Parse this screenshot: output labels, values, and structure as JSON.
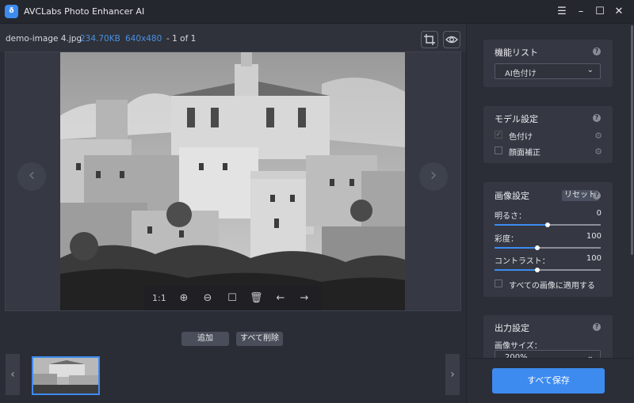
{
  "window": {
    "title": "AVCLabs Photo Enhancer AI",
    "logo_glyph": "ð",
    "controls": {
      "menu": "☰",
      "minimize": "–",
      "maximize": "☐",
      "close": "✕"
    }
  },
  "file_info": {
    "name": "demo-image 4.jpg",
    "size": "234.70KB",
    "dimensions": "640x480",
    "page": "- 1 of 1"
  },
  "viewer": {
    "prev": "‹",
    "next": "›",
    "toolbar": {
      "ratio": "1:1",
      "zoom_in": "⊕",
      "zoom_out": "⊖",
      "fit": "☐",
      "delete": "🗑",
      "back": "←",
      "forward": "→"
    }
  },
  "bottom": {
    "add_label": "追加",
    "delete_all_label": "すべて削除",
    "prev": "‹",
    "next": "›"
  },
  "panel": {
    "features": {
      "title": "機能リスト",
      "help": "?",
      "selected": "AI色付け",
      "chevron": "⌄"
    },
    "model": {
      "title": "モデル設定",
      "help": "?",
      "options": [
        {
          "label": "色付け",
          "checked": true,
          "check_glyph": "✓"
        },
        {
          "label": "顔面補正",
          "checked": false,
          "check_glyph": ""
        }
      ],
      "gear": "⚙"
    },
    "image": {
      "title": "画像設定",
      "reset_label": "リセット",
      "help": "?",
      "brightness": {
        "label": "明るさ：",
        "value": "0",
        "fraction": 0.5
      },
      "saturation": {
        "label": "彩度：",
        "value": "100",
        "fraction": 0.4
      },
      "contrast": {
        "label": "コントラスト：",
        "value": "100",
        "fraction": 0.4
      },
      "apply_all": "すべての画像に適用する"
    },
    "output": {
      "title": "出力設定",
      "help": "?",
      "size_label": "画像サイズ：",
      "size_value": "200%"
    },
    "save_all": "すべて保存"
  },
  "colors": {
    "accent": "#3d8bef",
    "bg": "#2a2d36",
    "panel": "#353843"
  }
}
